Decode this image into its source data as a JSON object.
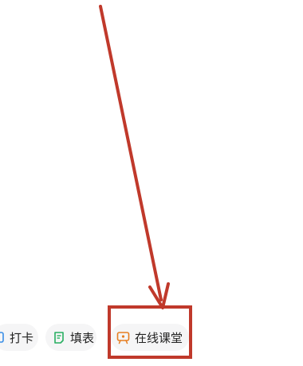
{
  "toolbar": {
    "checkin_label": "打卡",
    "form_label": "填表",
    "classroom_label": "在线课堂"
  },
  "icons": {
    "checkin": "checkin-icon",
    "form": "form-icon",
    "classroom": "classroom-icon"
  },
  "colors": {
    "annotation": "#c0392b",
    "pill_background": "#f5f5f6",
    "form_icon": "#27ae60",
    "classroom_icon": "#e67e22"
  }
}
